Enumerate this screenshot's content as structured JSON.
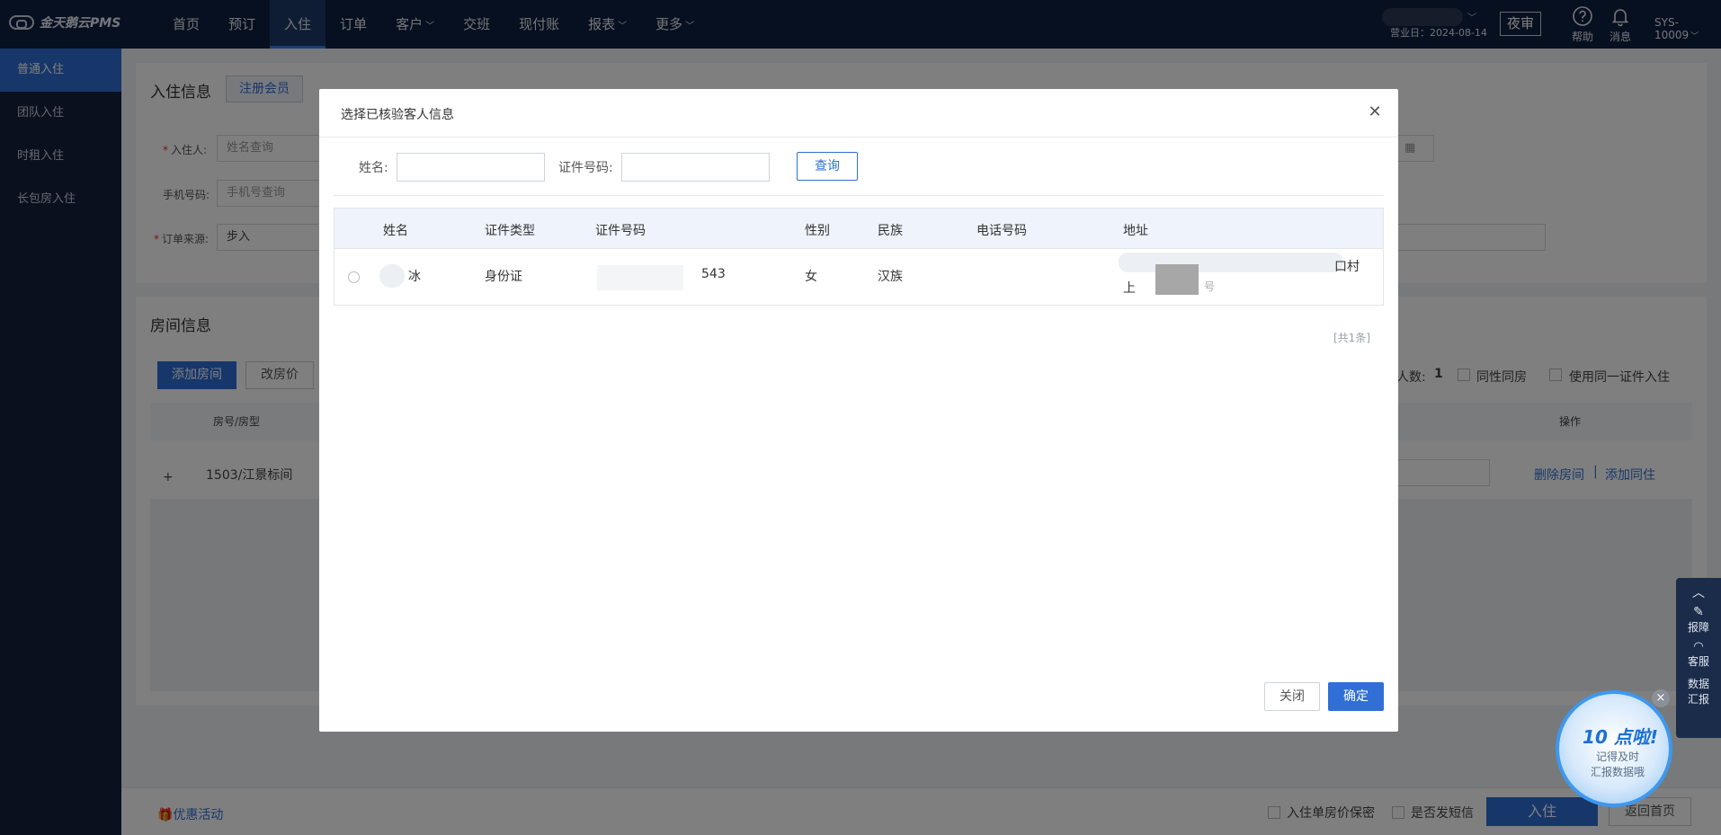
{
  "brand": {
    "name": "金天鹅云PMS"
  },
  "nav": {
    "items": [
      {
        "label": "首页",
        "caret": false
      },
      {
        "label": "预订",
        "caret": false
      },
      {
        "label": "入住",
        "caret": false,
        "active": true
      },
      {
        "label": "订单",
        "caret": false
      },
      {
        "label": "客户",
        "caret": true
      },
      {
        "label": "交班",
        "caret": false
      },
      {
        "label": "现付账",
        "caret": false
      },
      {
        "label": "报表",
        "caret": true
      },
      {
        "label": "更多",
        "caret": true
      }
    ],
    "business_date": "营业日：2024-08-14",
    "night_audit": "夜审",
    "help": "帮助",
    "messages": "消息",
    "user": "SYS-10009"
  },
  "sidebar": {
    "items": [
      {
        "label": "普通入住",
        "active": true
      },
      {
        "label": "团队入住"
      },
      {
        "label": "时租入住"
      },
      {
        "label": "长包房入住"
      }
    ]
  },
  "checkin_info": {
    "title": "入住信息",
    "register_member": "注册会员",
    "guest_label": "入住人:",
    "guest_placeholder": "姓名查询",
    "phone_label": "手机号码:",
    "phone_placeholder": "手机号查询",
    "source_label": "订单来源:",
    "source_value": "步入"
  },
  "room_info": {
    "title": "房间信息",
    "add_room": "添加房间",
    "change_price": "改房价",
    "guests_label": "人数:",
    "guests_value": "1",
    "same_sex": "同性同房",
    "same_id": "使用同一证件入住",
    "col_room": "房号/房型",
    "col_action": "操作",
    "row_room": "1503/江景标间",
    "delete_room": "删除房间",
    "separator": "|",
    "add_cohabitant": "添加同住"
  },
  "footer": {
    "promo": "优惠活动",
    "price_secret": "入住单房价保密",
    "send_sms": "是否发短信",
    "checkin": "入住",
    "back_home": "返回首页"
  },
  "float_tools": {
    "report_issue": "报障",
    "service": "客服",
    "data_report_1": "数据",
    "data_report_2": "汇报"
  },
  "promo_badge": {
    "big": "10 点啦!",
    "line1": "记得及时",
    "line2": "汇报数据哦"
  },
  "modal": {
    "title": "选择已核验客人信息",
    "name_label": "姓名:",
    "id_label": "证件号码:",
    "query": "查询",
    "columns": [
      "姓名",
      "证件类型",
      "证件号码",
      "性别",
      "民族",
      "电话号码",
      "地址"
    ],
    "rows": [
      {
        "name": "冰",
        "id_type": "身份证",
        "id_number": "543",
        "gender": "女",
        "ethnicity": "汉族",
        "phone": "",
        "address_line1": "口村",
        "address_line2a": "上",
        "address_line2b": "号"
      }
    ],
    "total": "[共1条]",
    "close": "关闭",
    "confirm": "确定"
  }
}
